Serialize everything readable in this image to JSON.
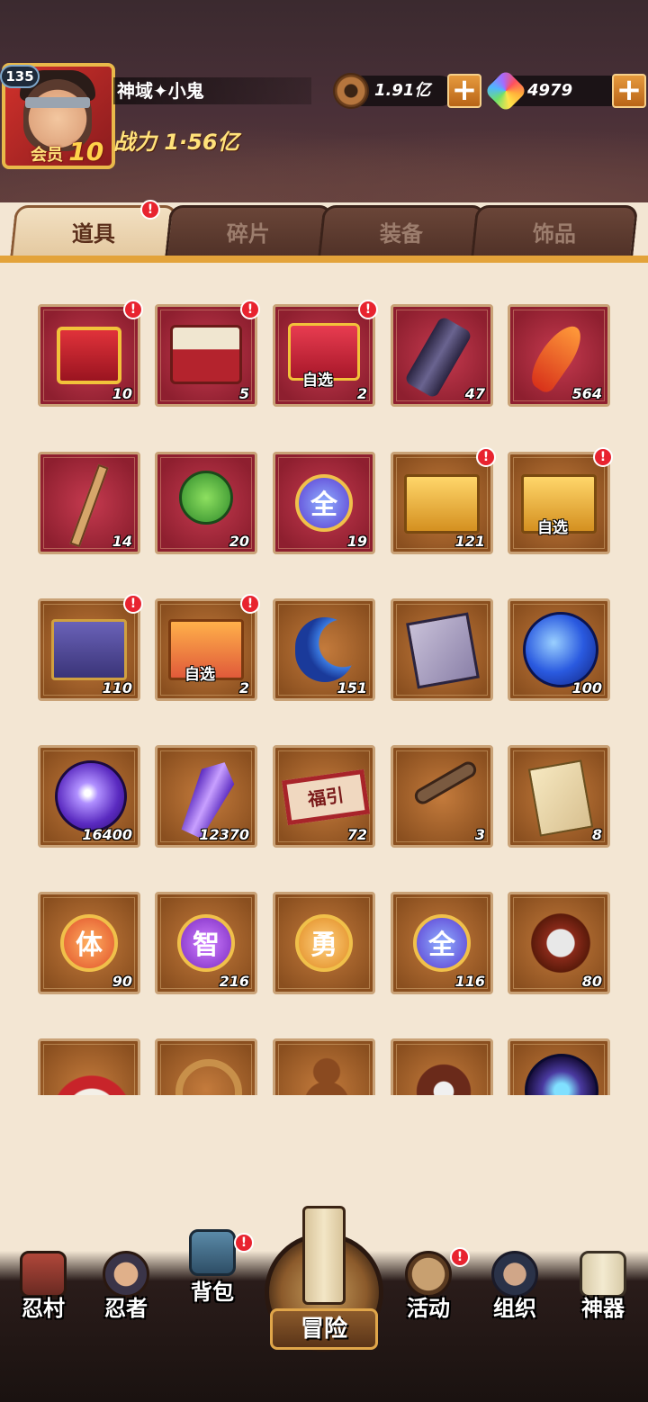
{
  "player": {
    "level": "135",
    "name": "神域✦小鬼",
    "vip_label": "会员",
    "vip_level": "10",
    "power": "战力 1·56亿"
  },
  "currency": {
    "coins": "1.91亿",
    "gems": "4979",
    "plus": "+"
  },
  "tabs": [
    {
      "label": "道具",
      "active": true,
      "badge": "!"
    },
    {
      "label": "碎片",
      "active": false
    },
    {
      "label": "装备",
      "active": false
    },
    {
      "label": "饰品",
      "active": false
    }
  ],
  "items": [
    {
      "icon": "red-gift-box-icon",
      "count": "10",
      "bg": "red",
      "badge": "!"
    },
    {
      "icon": "white-red-chest-icon",
      "count": "5",
      "bg": "red",
      "badge": "!"
    },
    {
      "icon": "select-gift-box-icon",
      "count": "2",
      "bg": "red",
      "badge": "!",
      "tag": "自选"
    },
    {
      "icon": "scroll-icon",
      "count": "47",
      "bg": "red"
    },
    {
      "icon": "flame-feather-icon",
      "count": "564",
      "bg": "red"
    },
    {
      "icon": "wooden-stick-icon",
      "count": "14",
      "bg": "red"
    },
    {
      "icon": "green-charm-icon",
      "count": "20",
      "bg": "red"
    },
    {
      "icon": "all-orb-icon",
      "count": "19",
      "bg": "red",
      "glyph": "全"
    },
    {
      "icon": "gold-chest-icon",
      "count": "121",
      "bg": "brown",
      "badge": "!"
    },
    {
      "icon": "gold-select-chest-icon",
      "count": "",
      "bg": "brown",
      "badge": "!",
      "tag": "自选"
    },
    {
      "icon": "purple-chest-icon",
      "count": "110",
      "bg": "brown",
      "badge": "!"
    },
    {
      "icon": "orange-select-chest-icon",
      "count": "2",
      "bg": "brown",
      "badge": "!",
      "tag": "自选"
    },
    {
      "icon": "blue-crescent-icon",
      "count": "151",
      "bg": "brown"
    },
    {
      "icon": "ninja-scroll-card-icon",
      "count": "",
      "bg": "brown"
    },
    {
      "icon": "blue-orb-icon",
      "count": "100",
      "bg": "brown"
    },
    {
      "icon": "purple-orb-icon",
      "count": "16400",
      "bg": "brown"
    },
    {
      "icon": "purple-crystal-icon",
      "count": "12370",
      "bg": "brown"
    },
    {
      "icon": "fortune-ticket-icon",
      "count": "72",
      "bg": "brown",
      "glyph_text": "福引"
    },
    {
      "icon": "key-icon",
      "count": "3",
      "bg": "brown"
    },
    {
      "icon": "paper-talisman-icon",
      "count": "8",
      "bg": "brown"
    },
    {
      "icon": "body-orb-icon",
      "count": "90",
      "bg": "brown",
      "glyph": "体"
    },
    {
      "icon": "wisdom-orb-icon",
      "count": "216",
      "bg": "brown",
      "glyph": "智"
    },
    {
      "icon": "courage-orb-icon",
      "count": "",
      "bg": "brown",
      "glyph": "勇"
    },
    {
      "icon": "all-attr-orb-icon",
      "count": "116",
      "bg": "brown",
      "glyph": "全"
    },
    {
      "icon": "silver-scroll-icon",
      "count": "80",
      "bg": "brown"
    },
    {
      "icon": "feather-fan-icon",
      "count": "",
      "bg": "brown"
    },
    {
      "icon": "rope-icon",
      "count": "",
      "bg": "brown"
    },
    {
      "icon": "gourd-icon",
      "count": "",
      "bg": "brown"
    },
    {
      "icon": "weapon-bundle-icon",
      "count": "",
      "bg": "brown"
    },
    {
      "icon": "blue-flame-orb-icon",
      "count": "",
      "bg": "brown"
    }
  ],
  "nav": [
    {
      "label": "忍村",
      "icon": "village-gate-icon"
    },
    {
      "label": "忍者",
      "icon": "ninja-icon"
    },
    {
      "label": "背包",
      "icon": "backpack-icon",
      "badge": "!"
    },
    {
      "label": "冒险",
      "icon": "adventure-scroll-icon"
    },
    {
      "label": "活动",
      "icon": "activity-icon",
      "badge": "!"
    },
    {
      "label": "组织",
      "icon": "organization-icon"
    },
    {
      "label": "神器",
      "icon": "artifact-icon"
    }
  ],
  "colors": {
    "accent": "#e3a33a",
    "badge": "#e8232f",
    "cell_red": "#8e1f2f",
    "cell_brown": "#8a4f1f"
  }
}
